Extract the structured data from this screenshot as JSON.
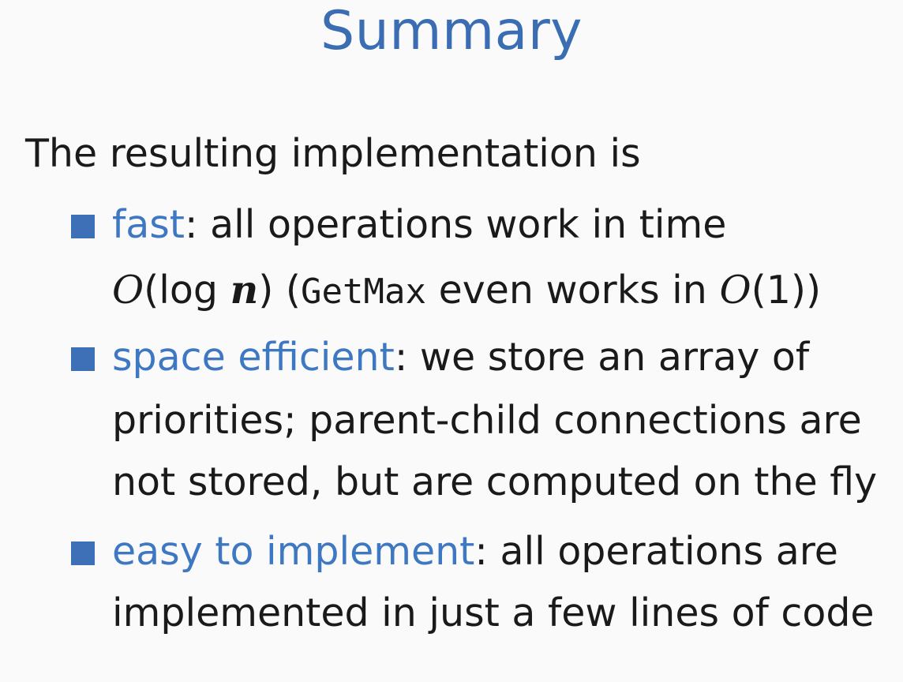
{
  "slide": {
    "title": "Summary",
    "intro": "The resulting implementation is",
    "accent_color": "#3f78c2",
    "bullet_color": "#3d70b6",
    "items": [
      {
        "term": "fast",
        "colon": ":",
        "line1_rest": " all operations work in time",
        "line2": {
          "big_o_1": "O",
          "paren_open_1": "(",
          "log": "log ",
          "n": "n",
          "paren_close_1": ")",
          "paren_open_outer": " (",
          "code": "GetMax",
          "mid_text": " even works in ",
          "big_o_2": "O",
          "paren_open_2": "(",
          "one": "1",
          "paren_close_2": "))"
        }
      },
      {
        "term": "space efficient",
        "colon": ":",
        "line1_rest": " we store an array of",
        "line2": "priorities; parent-child connections are",
        "line3": "not stored, but are computed on the fly"
      },
      {
        "term": "easy to implement",
        "colon": ":",
        "line1_rest": " all operations are",
        "line2": "implemented in just a few lines of code"
      }
    ]
  }
}
